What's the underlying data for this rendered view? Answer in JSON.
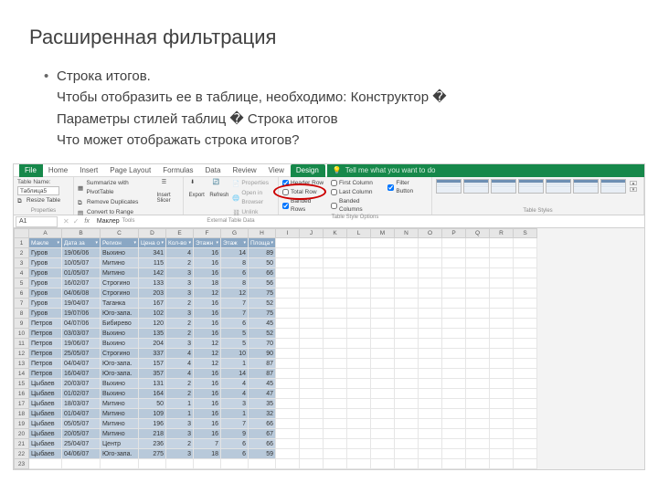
{
  "slide": {
    "title": "Расширенная фильтрация",
    "bullet1": "Строка итогов.",
    "line2": "Чтобы отобразить ее в таблице, необходимо:  Конструктор �",
    "line3": "Параметры стилей таблиц � Строка итогов",
    "line4": "Что может отображать строка итогов?"
  },
  "tabs": [
    "File",
    "Home",
    "Insert",
    "Page Layout",
    "Formulas",
    "Data",
    "Review",
    "View",
    "Design"
  ],
  "activeTab": "Design",
  "tellme": "Tell me what you want to do",
  "ribbon": {
    "props": {
      "label": "Properties",
      "name_lbl": "Table Name:",
      "name_val": "Таблица5",
      "resize": "Resize Table"
    },
    "tools": {
      "label": "Tools",
      "pivot": "Summarize with PivotTable",
      "dup": "Remove Duplicates",
      "range": "Convert to Range",
      "slicer": "Insert\nSlicer"
    },
    "ext": {
      "label": "External Table Data",
      "export": "Export",
      "refresh": "Refresh",
      "p": "Properties",
      "o": "Open in Browser",
      "u": "Unlink"
    },
    "opts": {
      "label": "Table Style Options",
      "header": "Header Row",
      "total": "Total Row",
      "banded": "Banded Rows",
      "first": "First Column",
      "last": "Last Column",
      "bandedc": "Banded Columns",
      "filter": "Filter Button"
    },
    "styles": {
      "label": "Table Styles"
    }
  },
  "namebox": "A1",
  "fxval": "Маклер",
  "cols": [
    "A",
    "B",
    "C",
    "D",
    "E",
    "F",
    "G",
    "H",
    "I",
    "J",
    "K",
    "L",
    "M",
    "N",
    "O",
    "P",
    "Q",
    "R",
    "S"
  ],
  "headers": [
    "Макле",
    "Дата за",
    "Регион",
    "Цена о",
    "Кол-во",
    "Этажн",
    "Этаж",
    "Площа"
  ],
  "rows": [
    {
      "n": 2,
      "d": [
        "Гуров",
        "19/06/06",
        "Выхино",
        "341",
        "4",
        "16",
        "14",
        "89"
      ]
    },
    {
      "n": 3,
      "d": [
        "Гуров",
        "10/05/07",
        "Митино",
        "115",
        "2",
        "16",
        "8",
        "50"
      ]
    },
    {
      "n": 4,
      "d": [
        "Гуров",
        "01/05/07",
        "Митино",
        "142",
        "3",
        "16",
        "6",
        "66"
      ]
    },
    {
      "n": 5,
      "d": [
        "Гуров",
        "16/02/07",
        "Строгино",
        "133",
        "3",
        "18",
        "8",
        "56"
      ]
    },
    {
      "n": 6,
      "d": [
        "Гуров",
        "04/06/08",
        "Строгино",
        "203",
        "3",
        "12",
        "12",
        "75"
      ]
    },
    {
      "n": 7,
      "d": [
        "Гуров",
        "19/04/07",
        "Таганка",
        "167",
        "2",
        "16",
        "7",
        "52"
      ]
    },
    {
      "n": 8,
      "d": [
        "Гуров",
        "19/07/06",
        "Юго-запа.",
        "102",
        "3",
        "16",
        "7",
        "75"
      ]
    },
    {
      "n": 9,
      "d": [
        "Петров",
        "04/07/06",
        "Бибирево",
        "120",
        "2",
        "16",
        "6",
        "45"
      ]
    },
    {
      "n": 10,
      "d": [
        "Петров",
        "03/03/07",
        "Выхино",
        "135",
        "2",
        "16",
        "5",
        "52"
      ]
    },
    {
      "n": 11,
      "d": [
        "Петров",
        "19/06/07",
        "Выхино",
        "204",
        "3",
        "12",
        "5",
        "70"
      ]
    },
    {
      "n": 12,
      "d": [
        "Петров",
        "25/05/07",
        "Строгино",
        "337",
        "4",
        "12",
        "10",
        "90"
      ]
    },
    {
      "n": 13,
      "d": [
        "Петров",
        "04/04/07",
        "Юго-запа.",
        "157",
        "4",
        "12",
        "1",
        "87"
      ]
    },
    {
      "n": 14,
      "d": [
        "Петров",
        "16/04/07",
        "Юго-запа.",
        "357",
        "4",
        "16",
        "14",
        "87"
      ]
    },
    {
      "n": 15,
      "d": [
        "Цыбаев",
        "20/03/07",
        "Выхино",
        "131",
        "2",
        "16",
        "4",
        "45"
      ]
    },
    {
      "n": 16,
      "d": [
        "Цыбаев",
        "01/02/07",
        "Выхино",
        "164",
        "2",
        "16",
        "4",
        "47"
      ]
    },
    {
      "n": 17,
      "d": [
        "Цыбаев",
        "18/03/07",
        "Митино",
        "50",
        "1",
        "16",
        "3",
        "35"
      ]
    },
    {
      "n": 18,
      "d": [
        "Цыбаев",
        "01/04/07",
        "Митино",
        "109",
        "1",
        "16",
        "1",
        "32"
      ]
    },
    {
      "n": 19,
      "d": [
        "Цыбаев",
        "05/05/07",
        "Митино",
        "196",
        "3",
        "16",
        "7",
        "66"
      ]
    },
    {
      "n": 20,
      "d": [
        "Цыбаев",
        "20/05/07",
        "Митино",
        "218",
        "3",
        "16",
        "9",
        "67"
      ]
    },
    {
      "n": 21,
      "d": [
        "Цыбаев",
        "25/04/07",
        "Центр",
        "236",
        "2",
        "7",
        "6",
        "66"
      ]
    },
    {
      "n": 22,
      "d": [
        "Цыбаев",
        "04/06/07",
        "Юго-запа.",
        "275",
        "3",
        "18",
        "6",
        "59"
      ]
    }
  ],
  "empty_row": 23
}
